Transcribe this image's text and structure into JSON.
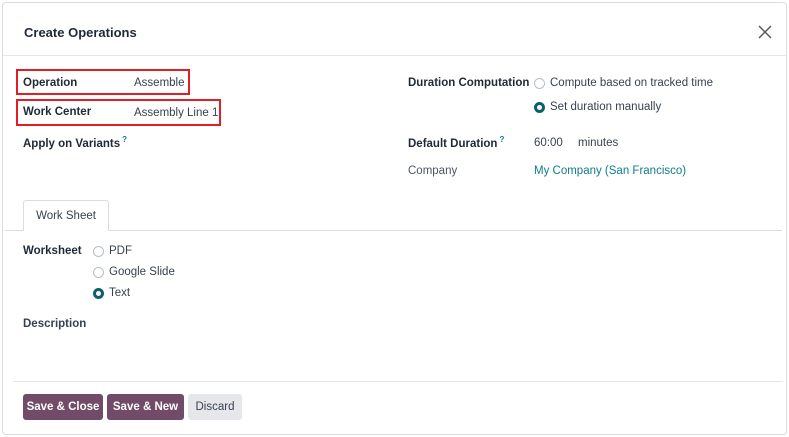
{
  "dialog": {
    "title": "Create Operations",
    "close_icon": "close-icon"
  },
  "left_fields": {
    "operation_label": "Operation",
    "operation_value": "Assemble",
    "work_center_label": "Work Center",
    "work_center_value": "Assembly Line 1",
    "apply_on_variants_label": "Apply on Variants",
    "apply_on_variants_help": "?"
  },
  "right_fields": {
    "duration_computation_label": "Duration Computation",
    "duration_options": [
      {
        "label": "Compute based on tracked time",
        "checked": false
      },
      {
        "label": "Set duration manually",
        "checked": true
      }
    ],
    "default_duration_label": "Default Duration",
    "default_duration_help": "?",
    "default_duration_value": "60:00",
    "default_duration_unit": "minutes",
    "company_label": "Company",
    "company_value": "My Company (San Francisco)"
  },
  "tabs": [
    {
      "label": "Work Sheet",
      "active": true
    }
  ],
  "worksheet": {
    "label": "Worksheet",
    "options": [
      {
        "label": "PDF",
        "checked": false
      },
      {
        "label": "Google Slide",
        "checked": false
      },
      {
        "label": "Text",
        "checked": true
      }
    ],
    "description_label": "Description"
  },
  "footer": {
    "save_close_label": "Save & Close",
    "save_new_label": "Save & New",
    "discard_label": "Discard"
  },
  "colors": {
    "primary_button": "#714b67",
    "link": "#0f7c8a",
    "radio_checked": "#0f5e6d",
    "highlight": "#e11d26"
  }
}
